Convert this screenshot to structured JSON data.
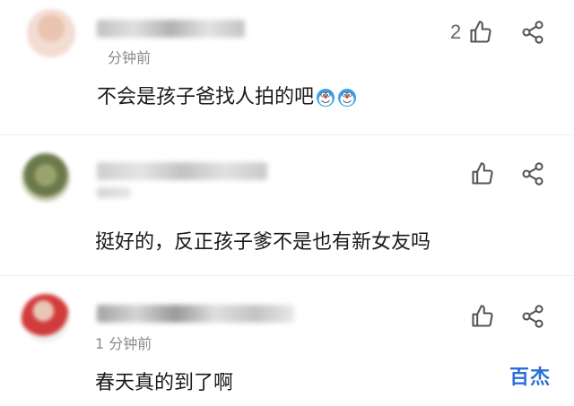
{
  "comments": [
    {
      "time": "分钟前",
      "text": "不会是孩子爸找人拍的吧",
      "emojis": [
        "doraemon-emoji",
        "doraemon-emoji"
      ],
      "like_count": "2"
    },
    {
      "time": "",
      "text": "挺好的，反正孩子爹不是也有新女友吗",
      "like_count": ""
    },
    {
      "time": "1 分钟前",
      "text": "春天真的到了啊",
      "like_count": ""
    }
  ],
  "watermark": "百杰",
  "colors": {
    "accent": "#2b6ed9",
    "icon": "#555555",
    "secondary_text": "#8a8a8a"
  },
  "icons": {
    "like": "thumbs-up-icon",
    "share": "share-icon"
  }
}
